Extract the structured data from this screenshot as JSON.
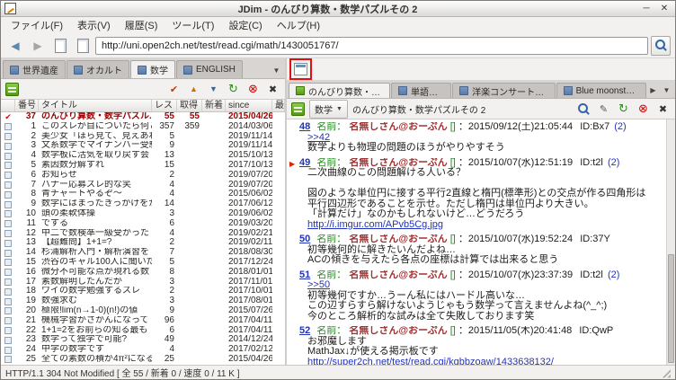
{
  "window": {
    "title": "JDim - のんびり算数・数学パズルその 2"
  },
  "icons": {
    "minimize": "─",
    "close": "✕",
    "back": "◀",
    "forward": "▶",
    "check": "✔",
    "up": "▲",
    "down": "▼",
    "reload": "↻",
    "stop": "⊗",
    "close_small": "✖",
    "dropdown": "▼",
    "scroll_right": "▶",
    "bookmark": "▶",
    "pen": "✎"
  },
  "menubar": {
    "items": [
      {
        "label": "ファイル(F)"
      },
      {
        "label": "表示(V)"
      },
      {
        "label": "履歴(S)"
      },
      {
        "label": "ツール(T)"
      },
      {
        "label": "設定(C)"
      },
      {
        "label": "ヘルプ(H)"
      }
    ]
  },
  "toolbar": {
    "url": "http://uni.open2ch.net/test/read.cgi/math/1430051767/"
  },
  "left": {
    "tabs": [
      {
        "label": "世界遺産",
        "cls": ""
      },
      {
        "label": "オカルト",
        "cls": ""
      },
      {
        "label": "数学",
        "cls": "active"
      },
      {
        "label": "ENGLISH",
        "cls": ""
      }
    ],
    "table": {
      "headers": [
        "",
        "番号",
        "タイトル",
        "レス",
        "取得",
        "新着",
        "since",
        "最終書込"
      ],
      "rows": [
        {
          "cls": "selected",
          "num": "37",
          "title": "のんびり算数・数学パズル...",
          "res": "55",
          "got": "55",
          "neu": "",
          "since": "2015/04/26",
          "last": ""
        },
        {
          "num": "1",
          "title": "このスレが目についたら何と",
          "res": "357",
          "got": "359",
          "since": "2014/03/06"
        },
        {
          "num": "2",
          "title": "美少女「ほら見て、見えあわ",
          "res": "5",
          "since": "2019/11/14"
        },
        {
          "num": "3",
          "title": "文系数学でマイナンバー受験",
          "res": "9",
          "since": "2019/11/14"
        },
        {
          "num": "4",
          "title": "数学板に活気を取り戻す会",
          "res": "13",
          "since": "2015/10/13"
        },
        {
          "num": "5",
          "title": "素因数分解すれ",
          "res": "15",
          "since": "2017/10/13"
        },
        {
          "num": "6",
          "title": "お知らせ",
          "res": "2",
          "since": "2019/07/20"
        },
        {
          "num": "7",
          "title": "バナー応募スレ的な笑",
          "res": "4",
          "since": "2019/07/20"
        },
        {
          "num": "8",
          "title": "青チャートやるぞ〜",
          "res": "4",
          "since": "2015/06/02"
        },
        {
          "num": "9",
          "title": "数学にはまったきっかけをか",
          "res": "14",
          "since": "2017/06/12"
        },
        {
          "num": "10",
          "title": "頭の柔軟体操",
          "res": "3",
          "since": "2019/06/02"
        },
        {
          "num": "11",
          "title": "でする",
          "res": "6",
          "since": "2019/03/20"
        },
        {
          "num": "12",
          "title": "中二で数検準一級受かった",
          "res": "4",
          "since": "2019/02/21"
        },
        {
          "num": "13",
          "title": "【超難問】1+1=?",
          "res": "2",
          "since": "2019/02/11"
        },
        {
          "num": "14",
          "title": "杉浦解析入門・解析演習を",
          "res": "7",
          "since": "2018/08/30"
        },
        {
          "num": "15",
          "title": "渋谷のギャル100人に聞いた",
          "res": "5",
          "since": "2017/12/24"
        },
        {
          "num": "16",
          "title": "微分不可能な点が現れる数",
          "res": "8",
          "since": "2018/01/01"
        },
        {
          "num": "17",
          "title": "素数解明したんだが",
          "res": "3",
          "since": "2017/11/01"
        },
        {
          "num": "18",
          "title": "ワイの数学勉強するスレ",
          "res": "2",
          "since": "2017/10/01"
        },
        {
          "num": "19",
          "title": "数強求む",
          "res": "3",
          "since": "2017/08/01"
        },
        {
          "num": "20",
          "title": "極限!lim(n→1-0)(n!)の値",
          "res": "9",
          "since": "2015/07/26"
        },
        {
          "num": "21",
          "title": "機械学習がさかんになって",
          "res": "96",
          "since": "2017/04/11"
        },
        {
          "num": "22",
          "title": "1+1=2をお前らの知る最も",
          "res": "6",
          "since": "2017/04/11"
        },
        {
          "num": "23",
          "title": "数学って独学で可能?",
          "res": "49",
          "since": "2014/12/24"
        },
        {
          "num": "24",
          "title": "中学の数学です",
          "res": "4",
          "since": "2017/02/12"
        },
        {
          "num": "25",
          "title": "全ての素数の積が4π²になる",
          "res": "25",
          "since": "2015/04/26"
        }
      ]
    }
  },
  "right": {
    "tabs": [
      {
        "label": "のんびり算数・数...",
        "cls": "active"
      },
      {
        "label": "単語スレ",
        "cls": ""
      },
      {
        "label": "洋楽コンサートスレ",
        "cls": ""
      },
      {
        "label": "Blue moonston...",
        "cls": ""
      }
    ],
    "board_label": "数学",
    "thread_title": "のんびり算数・数学パズルその 2",
    "name_label": "名前：",
    "posts": [
      {
        "cls": "",
        "num": "48",
        "name": "名無しさん@おーぷん",
        "mail": "[]",
        "date": "：2015/09/12(土)21:05:44",
        "id": "ID:Bx7",
        "id_count": "(2)",
        "lines": [
          {
            "cls": "anchor",
            "t": ">>42"
          },
          {
            "cls": "",
            "t": "数学よりも物理の問題のほうがやりやすそう"
          }
        ]
      },
      {
        "cls": "marked",
        "num": "49",
        "name": "名無しさん@おーぷん",
        "mail": "[]",
        "date": "：2015/10/07(水)12:51:19",
        "id": "ID:t2l",
        "id_count": "(2)",
        "lines": [
          {
            "cls": "",
            "t": "二次曲線のこの問題解ける人いる？"
          },
          {
            "cls": "",
            "t": ""
          },
          {
            "cls": "",
            "t": "図のような単位円に接する平行2直線と楕円(標準形)との交点が作る四角形は平行四辺形であることを示せ。ただし楕円は単位円より大きい。"
          },
          {
            "cls": "",
            "t": "「計算だけ」なのかもしれないけど…どうだろう"
          },
          {
            "cls": "link",
            "t": "http://i.imgur.com/APvb5Cg.jpg"
          }
        ]
      },
      {
        "cls": "",
        "num": "50",
        "name": "名無しさん@おーぷん",
        "mail": "[]",
        "date": "：2015/10/07(水)19:52:24",
        "id": "ID:37Y",
        "id_count": "",
        "lines": [
          {
            "cls": "",
            "t": "初等幾何的に解きたいんだよね…"
          },
          {
            "cls": "",
            "t": "ACの傾きを与えたら各点の座標は計算では出来ると思う"
          }
        ]
      },
      {
        "cls": "",
        "num": "51",
        "name": "名無しさん@おーぷん",
        "mail": "[]",
        "date": "：2015/10/07(水)23:37:39",
        "id": "ID:t2l",
        "id_count": "(2)",
        "lines": [
          {
            "cls": "anchor",
            "t": ">>50"
          },
          {
            "cls": "",
            "t": "初等幾何ですか…うーん私にはハードル高いな…"
          },
          {
            "cls": "",
            "t": "この辺すらすら解けないようじゃもう数学って言えませんよね(^_^;)"
          },
          {
            "cls": "",
            "t": "今のところ解析的な試みは全て失敗しております笑"
          }
        ]
      },
      {
        "cls": "",
        "num": "52",
        "name": "名無しさん@おーぷん",
        "mail": "[]",
        "date": "：2015/11/05(木)20:41:48",
        "id": "ID:QwP",
        "id_count": "",
        "lines": [
          {
            "cls": "",
            "t": "お邪魔します"
          },
          {
            "cls": "",
            "t": "MathJax↓が使える掲示板です"
          },
          {
            "cls": "link",
            "t": "http://super2ch.net/test/read.cgi/kqbbzoaw/1433638132/"
          }
        ]
      }
    ]
  },
  "statusbar": {
    "text": "HTTP/1.1 304 Not Modified [ 全 55 / 新着 0 / 速度 0 / 11 K ]"
  },
  "colors": {
    "link_blue": "#2233bb",
    "poster_name": "#a03232",
    "label_green": "#22881e",
    "selected_red": "#a40000",
    "annotation_red": "#dd1111",
    "board_green": "#4e9a06"
  }
}
